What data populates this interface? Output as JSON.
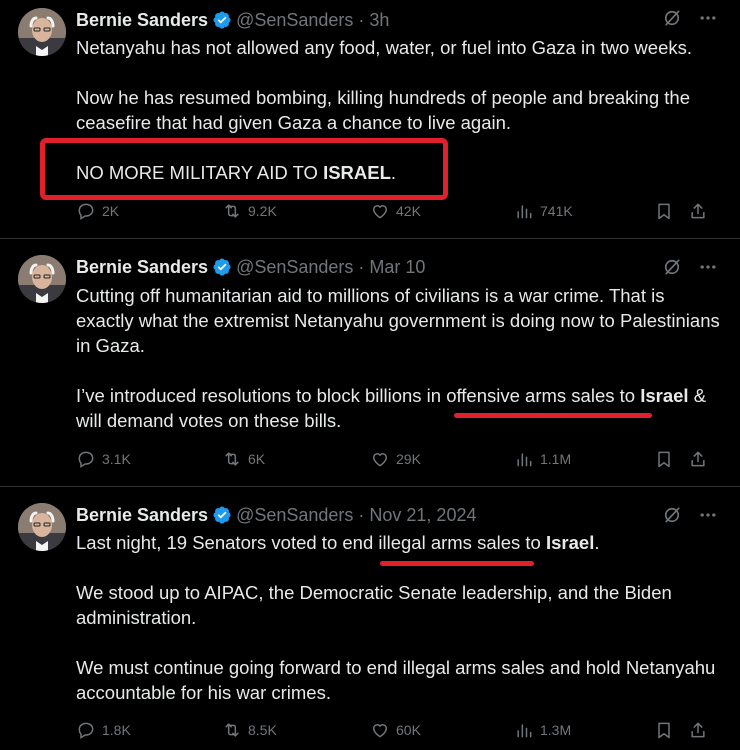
{
  "tweets": [
    {
      "name": "Bernie Sanders",
      "handle": "@SenSanders",
      "time": "· 3h",
      "paragraphs": [
        "Netanyahu has not allowed any food, water, or fuel into Gaza in two weeks.",
        "Now he has resumed bombing, killing hundreds of people and breaking the ceasefire that had given Gaza a chance to live again."
      ],
      "p3_pre": "NO MORE MILITARY AID TO ",
      "p3_bold": "ISRAEL",
      "p3_post": ".",
      "replies": "2K",
      "reposts": "9.2K",
      "likes": "42K",
      "views": "741K"
    },
    {
      "name": "Bernie Sanders",
      "handle": "@SenSanders",
      "time": "· Mar 10",
      "p1": "Cutting off humanitarian aid to millions of civilians is a war crime. That is exactly what the extremist Netanyahu government is doing now to Palestinians in Gaza.",
      "p2_pre": "I’ve introduced resolutions to block billions in offensive arms sales to ",
      "p2_bold": "Israel",
      "p2_post": " & will demand votes on these bills.",
      "replies": "3.1K",
      "reposts": "6K",
      "likes": "29K",
      "views": "1.1M"
    },
    {
      "name": "Bernie Sanders",
      "handle": "@SenSanders",
      "time": "· Nov 21, 2024",
      "p1_pre": "Last night, 19 Senators voted to end illegal arms sales to ",
      "p1_bold": "Israel",
      "p1_post": ".",
      "p2": "We stood up to AIPAC, the Democratic Senate leadership, and the Biden administration.",
      "p3": "We must continue going forward to end illegal arms sales and hold Netanyahu accountable for his war crimes.",
      "replies": "1.8K",
      "reposts": "8.5K",
      "likes": "60K",
      "views": "1.3M"
    }
  ],
  "colors": {
    "accent_red": "#e0202a",
    "verified_blue": "#1d9bf0",
    "muted": "#71767b"
  },
  "icons": [
    "verified-badge-icon",
    "grok-icon",
    "more-icon",
    "reply-icon",
    "repost-icon",
    "like-icon",
    "views-icon",
    "bookmark-icon",
    "share-icon"
  ]
}
